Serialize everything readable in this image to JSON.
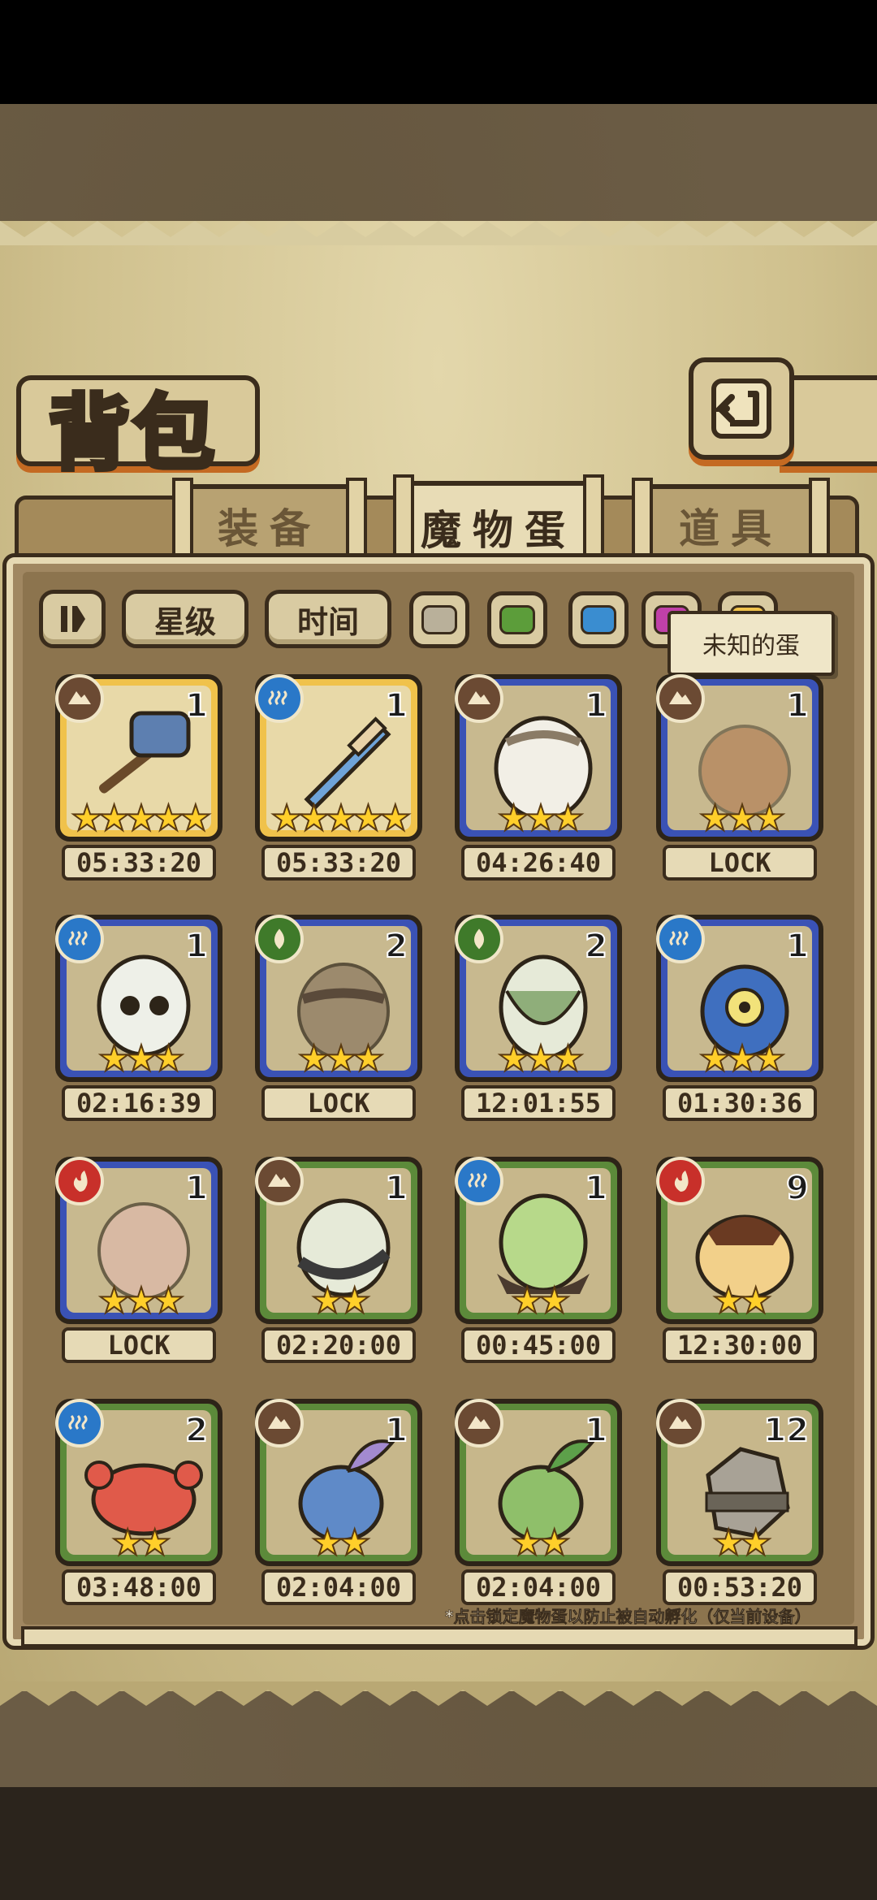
{
  "title": "背包",
  "tabs": [
    {
      "label": "装备",
      "active": false
    },
    {
      "label": "魔物蛋",
      "active": true
    },
    {
      "label": "道具",
      "active": false
    }
  ],
  "filters": {
    "sort_star": "星级",
    "sort_time": "时间"
  },
  "swatch_colors": [
    "#b9b09a",
    "#5c9d3a",
    "#3a8dd0",
    "#c040a8",
    "#f0c24b"
  ],
  "tooltip": "未知的蛋",
  "colors": {
    "earth": "#6b4a33",
    "water": "#2a78c8",
    "wood": "#3f7a2a",
    "fire": "#c8302a"
  },
  "eggs": [
    {
      "element": "earth",
      "count": "1",
      "stars": "★★★★★",
      "time": "05:33:20",
      "frame": "gold",
      "art": "hammer-icon"
    },
    {
      "element": "water",
      "count": "1",
      "stars": "★★★★★",
      "time": "05:33:20",
      "frame": "gold",
      "art": "sword-icon"
    },
    {
      "element": "earth",
      "count": "1",
      "stars": "★★★",
      "time": "04:26:40",
      "frame": "blue",
      "art": "owl-egg-icon"
    },
    {
      "element": "earth",
      "count": "1",
      "stars": "★★★",
      "time": "LOCK",
      "frame": "blue",
      "art": "fox-egg-icon"
    },
    {
      "element": "water",
      "count": "1",
      "stars": "★★★",
      "time": "02:16:39",
      "frame": "blue",
      "art": "skull-egg-icon"
    },
    {
      "element": "wood",
      "count": "2",
      "stars": "★★★",
      "time": "LOCK",
      "frame": "blue",
      "art": "spiked-egg-icon"
    },
    {
      "element": "wood",
      "count": "2",
      "stars": "★★★",
      "time": "12:01:55",
      "frame": "blue",
      "art": "leaf-egg-icon"
    },
    {
      "element": "water",
      "count": "1",
      "stars": "★★★",
      "time": "01:30:36",
      "frame": "blue",
      "art": "eye-egg-icon"
    },
    {
      "element": "fire",
      "count": "1",
      "stars": "★★★",
      "time": "LOCK",
      "frame": "blue",
      "art": "pink-egg-icon"
    },
    {
      "element": "earth",
      "count": "1",
      "stars": "★★",
      "time": "02:20:00",
      "frame": "green",
      "art": "spotted-egg-icon"
    },
    {
      "element": "water",
      "count": "1",
      "stars": "★★",
      "time": "00:45:00",
      "frame": "green",
      "art": "green-egg-icon"
    },
    {
      "element": "fire",
      "count": "9",
      "stars": "★★",
      "time": "12:30:00",
      "frame": "green",
      "art": "pudding-egg-icon"
    },
    {
      "element": "water",
      "count": "2",
      "stars": "★★",
      "time": "03:48:00",
      "frame": "green",
      "art": "crab-egg-icon"
    },
    {
      "element": "earth",
      "count": "1",
      "stars": "★★",
      "time": "02:04:00",
      "frame": "green",
      "art": "sprout-egg-purple-icon"
    },
    {
      "element": "earth",
      "count": "1",
      "stars": "★★",
      "time": "02:04:00",
      "frame": "green",
      "art": "sprout-egg-green-icon"
    },
    {
      "element": "earth",
      "count": "12",
      "stars": "★★",
      "time": "00:53:20",
      "frame": "green",
      "art": "rock-egg-icon"
    }
  ],
  "note": "*点击锁定魔物蛋以防止被自动孵化（仅当前设备）"
}
